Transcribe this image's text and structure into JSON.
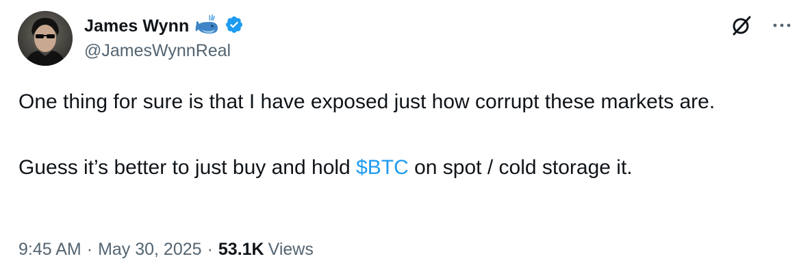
{
  "author": {
    "display_name": "James Wynn",
    "handle": "@JamesWynnReal",
    "badge_emoji": "whale-icon",
    "verified": true,
    "verified_color": "#1d9bf0"
  },
  "tweet": {
    "paragraph_1": "One thing for sure is that I have exposed just how corrupt these markets are.",
    "paragraph_2_before": "Guess it’s better to just buy and hold ",
    "cashtag": "$BTC",
    "paragraph_2_after": " on spot / cold storage it."
  },
  "meta": {
    "time": "9:45 AM",
    "separator": "·",
    "date": "May 30, 2025",
    "views_count": "53.1K",
    "views_label": "Views"
  },
  "icons": {
    "grok": "grok-icon",
    "more": "more-options-icon"
  },
  "colors": {
    "text_primary": "#0f1419",
    "text_secondary": "#536471",
    "accent": "#1d9bf0"
  }
}
